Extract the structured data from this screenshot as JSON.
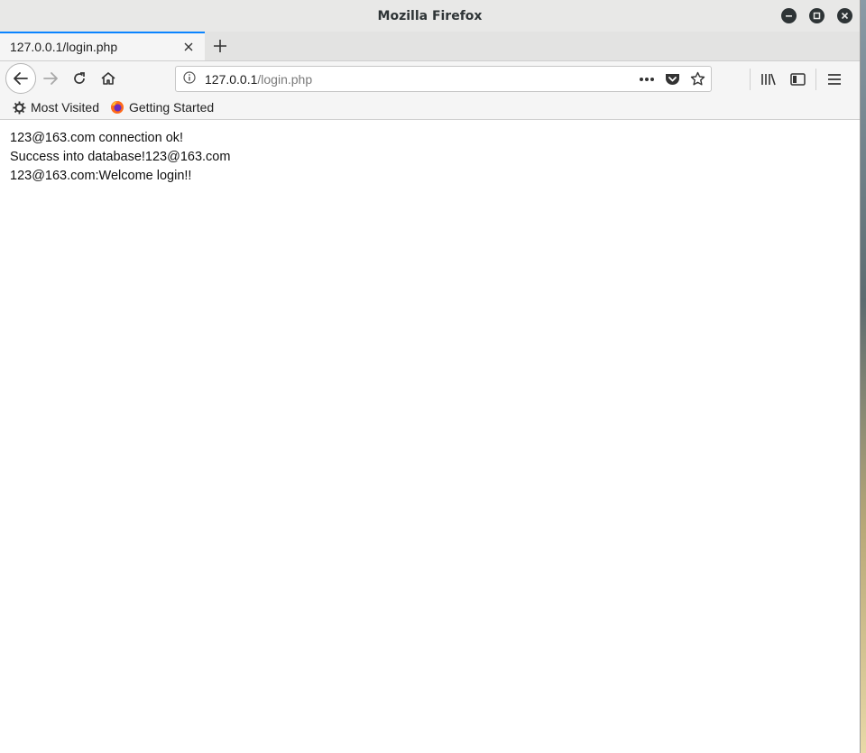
{
  "window": {
    "title": "Mozilla Firefox"
  },
  "tabs": [
    {
      "label": "127.0.0.1/login.php"
    }
  ],
  "urlbar": {
    "host": "127.0.0.1",
    "path": "/login.php"
  },
  "bookmarks": [
    {
      "label": "Most Visited",
      "icon": "gear-icon"
    },
    {
      "label": "Getting Started",
      "icon": "firefox-icon"
    }
  ],
  "content": {
    "lines": [
      "123@163.com connection ok!",
      "Success into database!123@163.com",
      "123@163.com:Welcome login!!"
    ]
  },
  "colors": {
    "tab_accent": "#0a84ff",
    "titlebar": "#e8e8e7",
    "toolbar": "#f5f5f5"
  }
}
